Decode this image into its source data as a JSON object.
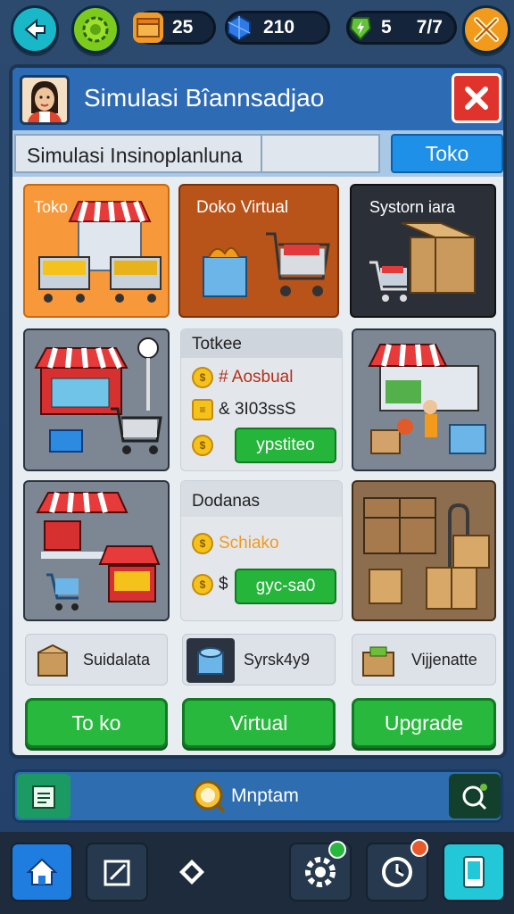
{
  "top_bar": {
    "resources": [
      {
        "name": "crate",
        "icon": "crate-icon",
        "value": "25"
      },
      {
        "name": "gem",
        "icon": "gem-icon",
        "value": "210"
      },
      {
        "name": "energy",
        "icon": "bolt-icon",
        "value": "5",
        "value2": "7/7"
      }
    ]
  },
  "panel": {
    "title": "Simulasi Bîannsadjao",
    "subtitle": "Simulasi Insinoplanluna",
    "shop_button": "Toko"
  },
  "tiles": [
    {
      "label": "Toko",
      "color": "#f7993a"
    },
    {
      "label": "Doko Virtual",
      "color": "#b8531a"
    },
    {
      "label": "Systorn iara",
      "color": "#2a2f38"
    }
  ],
  "cards": [
    {
      "header": "Totkee",
      "rows": [
        "# Aosbual",
        "& 3I03ssS"
      ],
      "button": "ypstiteo"
    },
    {
      "header": "Dodanas",
      "rows": [
        "Schiako",
        "$"
      ],
      "button": "gyc-sa0"
    }
  ],
  "chips": [
    {
      "label": "Suidalata"
    },
    {
      "label": "Syrsk4y9"
    },
    {
      "label": "Vijjenatte"
    }
  ],
  "action_buttons": [
    "To ko",
    "Virtual",
    "Upgrade"
  ],
  "search_bar": {
    "label": "Mnptam"
  },
  "colors": {
    "accent_blue": "#2d6bb5",
    "green": "#28b83d",
    "red": "#e0332b",
    "orange": "#f7993a"
  }
}
